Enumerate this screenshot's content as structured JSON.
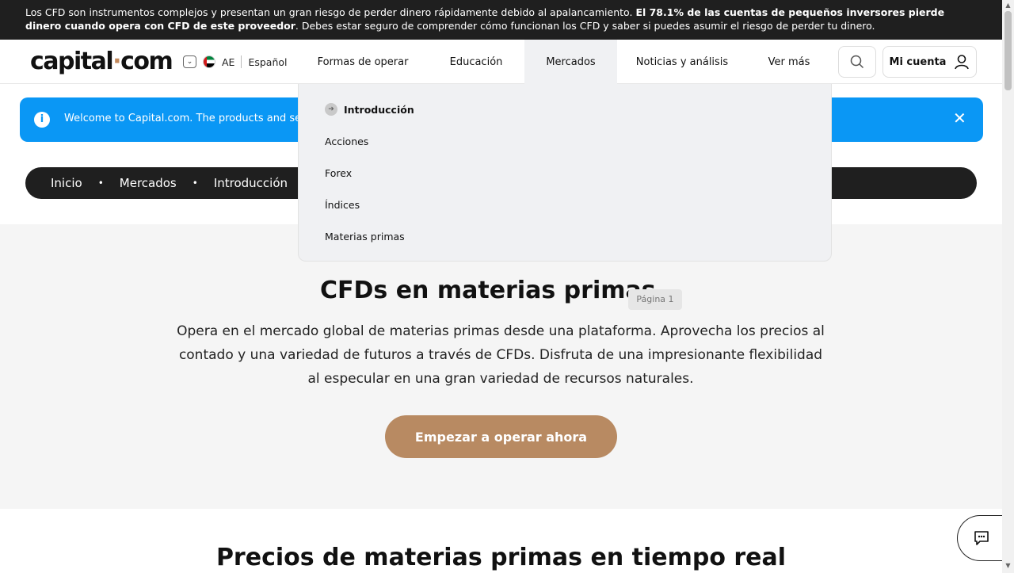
{
  "risk_warning": {
    "text_normal": "Los CFD son instrumentos complejos y presentan un gran riesgo de perder dinero rápidamente debido al apalancamiento. ",
    "text_bold": "El 78.1% de las cuentas de pequeños inversores pierde dinero cuando opera con CFD de este proveedor",
    "text_after": ". Debes estar seguro de comprender cómo funcionan los CFD y saber si puedes asumir el riesgo de perder tu dinero."
  },
  "header": {
    "logo_main": "capital",
    "logo_dot": "·",
    "logo_end": "com",
    "region_code": "AE",
    "language": "Español",
    "nav": [
      "Formas de operar",
      "Educación",
      "Mercados",
      "Noticias y análisis",
      "Ver más"
    ],
    "account_label": "Mi cuenta"
  },
  "notice": {
    "text": "Welcome to Capital.com. The products and servic"
  },
  "breadcrumb": [
    "Inicio",
    "Mercados",
    "Introducción"
  ],
  "dropdown": {
    "items": [
      "Introducción",
      "Acciones",
      "Forex",
      "Índices",
      "Materias primas"
    ]
  },
  "hero": {
    "title": "CFDs en materias primas",
    "page_badge": "Página 1",
    "description": "Opera en el mercado global de materias primas desde una plataforma. Aprovecha los precios al contado y una variedad de futuros a través de CFDs. Disfruta de una impresionante flexibilidad al especular en una gran variedad de recursos naturales.",
    "cta": "Empezar a operar ahora"
  },
  "section": {
    "title": "Precios de materias primas en tiempo real"
  },
  "colors": {
    "accent": "#b88a62",
    "info": "#0a97f5",
    "dark": "#1f1f1f"
  }
}
